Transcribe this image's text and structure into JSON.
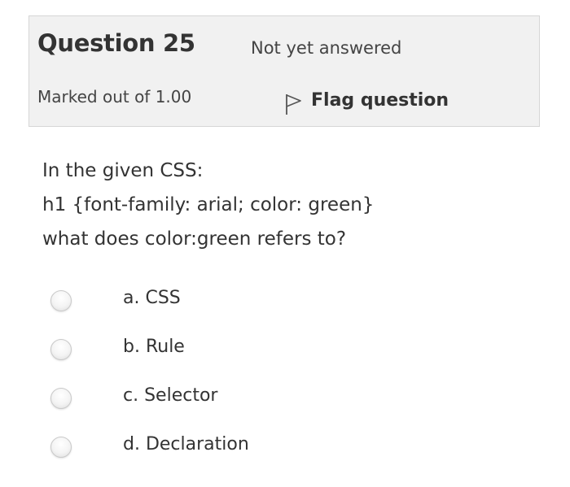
{
  "question_info": {
    "number_label": "Question 25",
    "state": "Not yet answered",
    "grade": "Marked out of 1.00",
    "flag_label": "Flag question",
    "flag_icon": "flag-icon"
  },
  "question_text": [
    "In the given CSS:",
    "h1 {font-family: arial; color: green}",
    "what does color:green refers to?"
  ],
  "answers": [
    {
      "label": "a. CSS",
      "selected": false
    },
    {
      "label": "b. Rule",
      "selected": false
    },
    {
      "label": "c. Selector",
      "selected": false
    },
    {
      "label": "d. Declaration",
      "selected": false
    }
  ]
}
